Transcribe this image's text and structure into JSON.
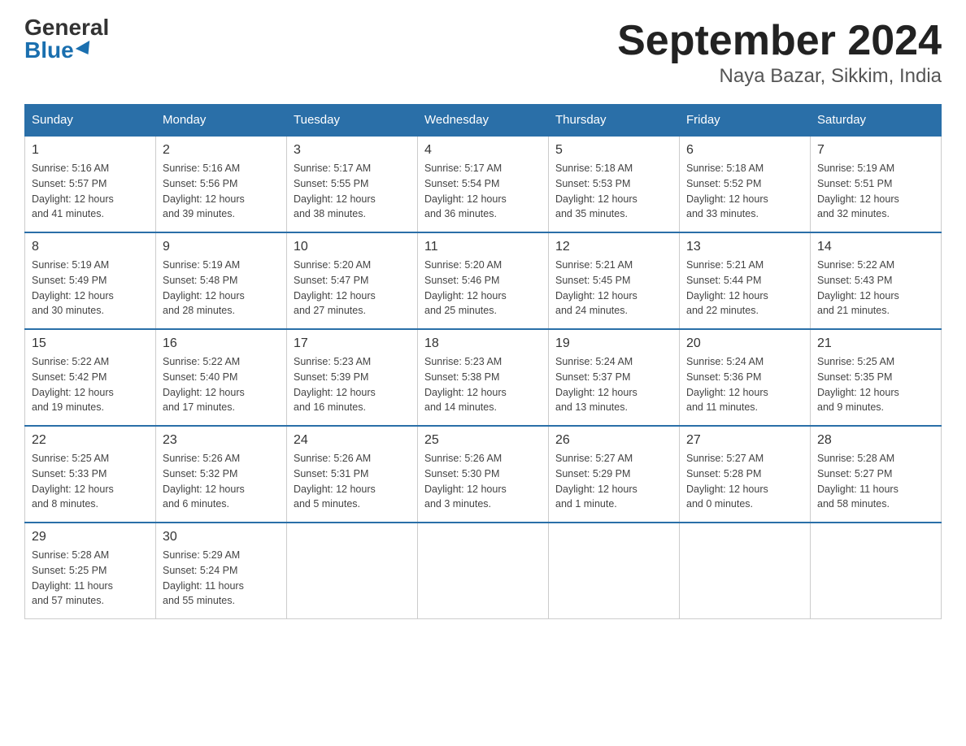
{
  "header": {
    "logo_line1": "General",
    "logo_line2": "Blue",
    "title": "September 2024",
    "subtitle": "Naya Bazar, Sikkim, India"
  },
  "columns": [
    "Sunday",
    "Monday",
    "Tuesday",
    "Wednesday",
    "Thursday",
    "Friday",
    "Saturday"
  ],
  "weeks": [
    [
      {
        "day": "1",
        "info": "Sunrise: 5:16 AM\nSunset: 5:57 PM\nDaylight: 12 hours\nand 41 minutes."
      },
      {
        "day": "2",
        "info": "Sunrise: 5:16 AM\nSunset: 5:56 PM\nDaylight: 12 hours\nand 39 minutes."
      },
      {
        "day": "3",
        "info": "Sunrise: 5:17 AM\nSunset: 5:55 PM\nDaylight: 12 hours\nand 38 minutes."
      },
      {
        "day": "4",
        "info": "Sunrise: 5:17 AM\nSunset: 5:54 PM\nDaylight: 12 hours\nand 36 minutes."
      },
      {
        "day": "5",
        "info": "Sunrise: 5:18 AM\nSunset: 5:53 PM\nDaylight: 12 hours\nand 35 minutes."
      },
      {
        "day": "6",
        "info": "Sunrise: 5:18 AM\nSunset: 5:52 PM\nDaylight: 12 hours\nand 33 minutes."
      },
      {
        "day": "7",
        "info": "Sunrise: 5:19 AM\nSunset: 5:51 PM\nDaylight: 12 hours\nand 32 minutes."
      }
    ],
    [
      {
        "day": "8",
        "info": "Sunrise: 5:19 AM\nSunset: 5:49 PM\nDaylight: 12 hours\nand 30 minutes."
      },
      {
        "day": "9",
        "info": "Sunrise: 5:19 AM\nSunset: 5:48 PM\nDaylight: 12 hours\nand 28 minutes."
      },
      {
        "day": "10",
        "info": "Sunrise: 5:20 AM\nSunset: 5:47 PM\nDaylight: 12 hours\nand 27 minutes."
      },
      {
        "day": "11",
        "info": "Sunrise: 5:20 AM\nSunset: 5:46 PM\nDaylight: 12 hours\nand 25 minutes."
      },
      {
        "day": "12",
        "info": "Sunrise: 5:21 AM\nSunset: 5:45 PM\nDaylight: 12 hours\nand 24 minutes."
      },
      {
        "day": "13",
        "info": "Sunrise: 5:21 AM\nSunset: 5:44 PM\nDaylight: 12 hours\nand 22 minutes."
      },
      {
        "day": "14",
        "info": "Sunrise: 5:22 AM\nSunset: 5:43 PM\nDaylight: 12 hours\nand 21 minutes."
      }
    ],
    [
      {
        "day": "15",
        "info": "Sunrise: 5:22 AM\nSunset: 5:42 PM\nDaylight: 12 hours\nand 19 minutes."
      },
      {
        "day": "16",
        "info": "Sunrise: 5:22 AM\nSunset: 5:40 PM\nDaylight: 12 hours\nand 17 minutes."
      },
      {
        "day": "17",
        "info": "Sunrise: 5:23 AM\nSunset: 5:39 PM\nDaylight: 12 hours\nand 16 minutes."
      },
      {
        "day": "18",
        "info": "Sunrise: 5:23 AM\nSunset: 5:38 PM\nDaylight: 12 hours\nand 14 minutes."
      },
      {
        "day": "19",
        "info": "Sunrise: 5:24 AM\nSunset: 5:37 PM\nDaylight: 12 hours\nand 13 minutes."
      },
      {
        "day": "20",
        "info": "Sunrise: 5:24 AM\nSunset: 5:36 PM\nDaylight: 12 hours\nand 11 minutes."
      },
      {
        "day": "21",
        "info": "Sunrise: 5:25 AM\nSunset: 5:35 PM\nDaylight: 12 hours\nand 9 minutes."
      }
    ],
    [
      {
        "day": "22",
        "info": "Sunrise: 5:25 AM\nSunset: 5:33 PM\nDaylight: 12 hours\nand 8 minutes."
      },
      {
        "day": "23",
        "info": "Sunrise: 5:26 AM\nSunset: 5:32 PM\nDaylight: 12 hours\nand 6 minutes."
      },
      {
        "day": "24",
        "info": "Sunrise: 5:26 AM\nSunset: 5:31 PM\nDaylight: 12 hours\nand 5 minutes."
      },
      {
        "day": "25",
        "info": "Sunrise: 5:26 AM\nSunset: 5:30 PM\nDaylight: 12 hours\nand 3 minutes."
      },
      {
        "day": "26",
        "info": "Sunrise: 5:27 AM\nSunset: 5:29 PM\nDaylight: 12 hours\nand 1 minute."
      },
      {
        "day": "27",
        "info": "Sunrise: 5:27 AM\nSunset: 5:28 PM\nDaylight: 12 hours\nand 0 minutes."
      },
      {
        "day": "28",
        "info": "Sunrise: 5:28 AM\nSunset: 5:27 PM\nDaylight: 11 hours\nand 58 minutes."
      }
    ],
    [
      {
        "day": "29",
        "info": "Sunrise: 5:28 AM\nSunset: 5:25 PM\nDaylight: 11 hours\nand 57 minutes."
      },
      {
        "day": "30",
        "info": "Sunrise: 5:29 AM\nSunset: 5:24 PM\nDaylight: 11 hours\nand 55 minutes."
      },
      {
        "day": "",
        "info": ""
      },
      {
        "day": "",
        "info": ""
      },
      {
        "day": "",
        "info": ""
      },
      {
        "day": "",
        "info": ""
      },
      {
        "day": "",
        "info": ""
      }
    ]
  ]
}
